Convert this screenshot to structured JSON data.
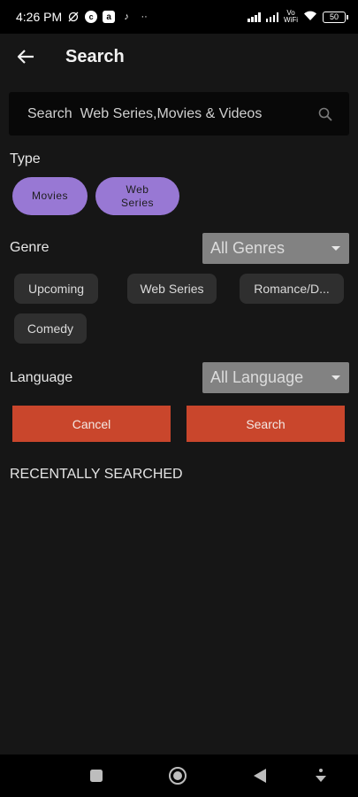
{
  "status_bar": {
    "time": "4:26 PM",
    "left_icons": [
      "muted-sync-icon",
      "c-app-icon",
      "a-app-icon",
      "tiktok-icon",
      "more-dots-icon"
    ],
    "vowifi_top": "Vo",
    "vowifi_bottom": "WiFi",
    "battery": "50"
  },
  "app_bar": {
    "title": "Search"
  },
  "search": {
    "placeholder": "Search  Web Series,Movies & Videos"
  },
  "type": {
    "label": "Type",
    "options": [
      "Movies",
      "Web\nSeries"
    ]
  },
  "genre": {
    "label": "Genre",
    "selected": "All Genres",
    "chips": [
      "Upcoming",
      "Web Series",
      "Romance/D...",
      "Comedy"
    ]
  },
  "language": {
    "label": "Language",
    "selected": "All Language"
  },
  "actions": {
    "cancel": "Cancel",
    "search": "Search"
  },
  "recent": {
    "heading": "RECENTALLY SEARCHED"
  },
  "colors": {
    "background": "#161616",
    "accent_pill": "#9878d4",
    "button": "#c9462c",
    "chip": "#2f2f2f",
    "dropdown": "#828282"
  }
}
